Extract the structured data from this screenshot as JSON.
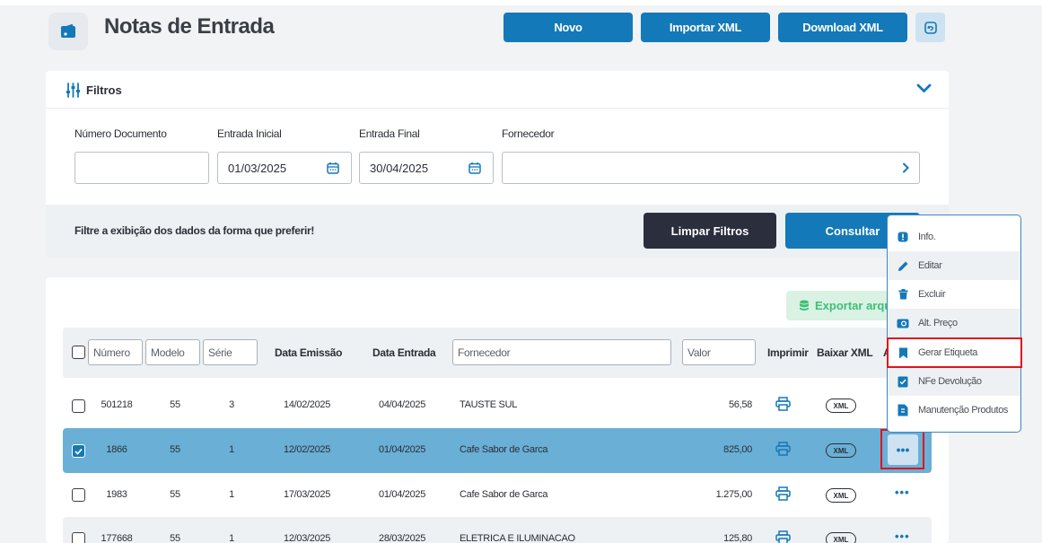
{
  "header": {
    "title": "Notas de Entrada",
    "buttons": {
      "new": "Novo",
      "import_xml": "Importar XML",
      "download_xml": "Download XML"
    }
  },
  "filters": {
    "title": "Filtros",
    "fields": {
      "document_number": {
        "label": "Número Documento",
        "value": ""
      },
      "entry_start": {
        "label": "Entrada Inicial",
        "value": "01/03/2025"
      },
      "entry_end": {
        "label": "Entrada Final",
        "value": "30/04/2025"
      },
      "supplier": {
        "label": "Fornecedor",
        "value": ""
      }
    },
    "hint": "Filtre a exibição dos dados da forma que preferir!",
    "clear_button": "Limpar Filtros",
    "query_button": "Consultar"
  },
  "table": {
    "export_button": "Exportar arquivo",
    "columns": {
      "numero": "Número",
      "modelo": "Modelo",
      "serie": "Série",
      "data_emissao": "Data Emissão",
      "data_entrada": "Data Entrada",
      "fornecedor": "Fornecedor",
      "valor": "Valor",
      "imprimir": "Imprimir",
      "baixar_xml": "Baixar XML",
      "acoes": "A"
    },
    "xml_badge": "XML",
    "rows": [
      {
        "numero": "501218",
        "modelo": "55",
        "serie": "3",
        "emissao": "14/02/2025",
        "entrada": "04/04/2025",
        "fornecedor": "TAUSTE SUL",
        "valor": "56,58",
        "checked": false
      },
      {
        "numero": "1866",
        "modelo": "55",
        "serie": "1",
        "emissao": "12/02/2025",
        "entrada": "01/04/2025",
        "fornecedor": "Cafe Sabor de Garca",
        "valor": "825,00",
        "checked": true
      },
      {
        "numero": "1983",
        "modelo": "55",
        "serie": "1",
        "emissao": "17/03/2025",
        "entrada": "01/04/2025",
        "fornecedor": "Cafe Sabor de Garca",
        "valor": "1.275,00",
        "checked": false
      },
      {
        "numero": "177668",
        "modelo": "55",
        "serie": "1",
        "emissao": "12/03/2025",
        "entrada": "28/03/2025",
        "fornecedor": "ELETRICA E ILUMINACAO",
        "valor": "125,80",
        "checked": false
      }
    ]
  },
  "context_menu": {
    "items": [
      {
        "label": "Info.",
        "icon": "info-icon"
      },
      {
        "label": "Editar",
        "icon": "pencil-icon"
      },
      {
        "label": "Excluir",
        "icon": "trash-icon"
      },
      {
        "label": "Alt. Preço",
        "icon": "price-tag-icon"
      },
      {
        "label": "Gerar Etiqueta",
        "icon": "bookmark-icon"
      },
      {
        "label": "NFe Devolução",
        "icon": "return-doc-icon"
      },
      {
        "label": "Manutenção Produtos",
        "icon": "product-doc-icon"
      }
    ]
  },
  "colors": {
    "primary": "#1479b8",
    "dark": "#2b2f3d",
    "selected_row": "#6aafd6",
    "highlight": "#e0141c",
    "export": "#3fbf75"
  }
}
